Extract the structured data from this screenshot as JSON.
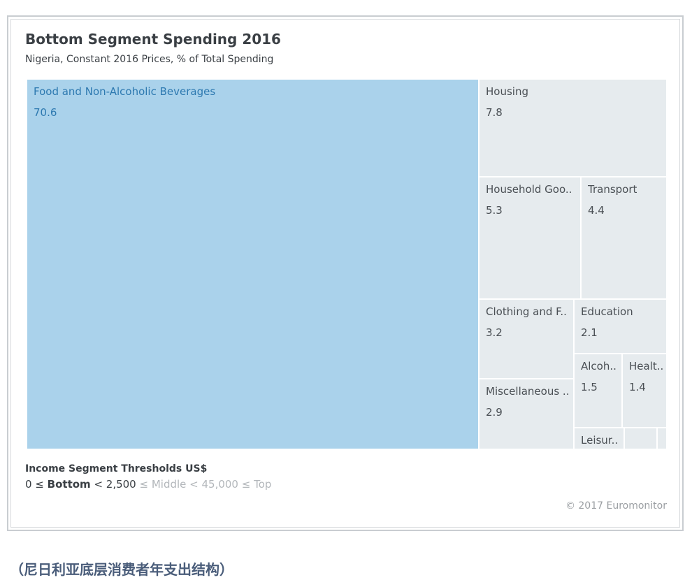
{
  "chart_data": {
    "type": "treemap",
    "title": "Bottom Segment Spending 2016",
    "subtitle": "Nigeria, Constant 2016 Prices, % of Total Spending",
    "tiles": [
      {
        "label": "Food and Non-Alcoholic Beverages",
        "value": 70.6,
        "value_label": "70.6"
      },
      {
        "label": "Housing",
        "value": 7.8,
        "value_label": "7.8"
      },
      {
        "label": "Household Goo..",
        "value": 5.3,
        "value_label": "5.3"
      },
      {
        "label": "Transport",
        "value": 4.4,
        "value_label": "4.4"
      },
      {
        "label": "Clothing and F..",
        "value": 3.2,
        "value_label": "3.2"
      },
      {
        "label": "Education",
        "value": 2.1,
        "value_label": "2.1"
      },
      {
        "label": "Miscellaneous ..",
        "value": 2.9,
        "value_label": "2.9"
      },
      {
        "label": "Alcoh..",
        "value": 1.5,
        "value_label": "1.5"
      },
      {
        "label": "Healt..",
        "value": 1.4,
        "value_label": "1.4"
      },
      {
        "label": "Leisur..",
        "value": null,
        "value_label": ""
      },
      {
        "label": "",
        "value": null,
        "value_label": ""
      },
      {
        "label": "",
        "value": null,
        "value_label": ""
      }
    ],
    "colors": {
      "highlight": "#aad2eb",
      "highlight_text": "#2d79b0",
      "other": "#e6ebee",
      "other_text": "#4a4f54"
    }
  },
  "thresholds": {
    "title": "Income Segment Thresholds US$",
    "prefix": "0 ≤ ",
    "bottom": "Bottom",
    "mid": " < 2,500 ",
    "rest": "≤ Middle < 45,000 ≤ Top"
  },
  "copyright": "© 2017 Euromonitor",
  "caption": "（尼日利亚底层消费者年支出结构）"
}
